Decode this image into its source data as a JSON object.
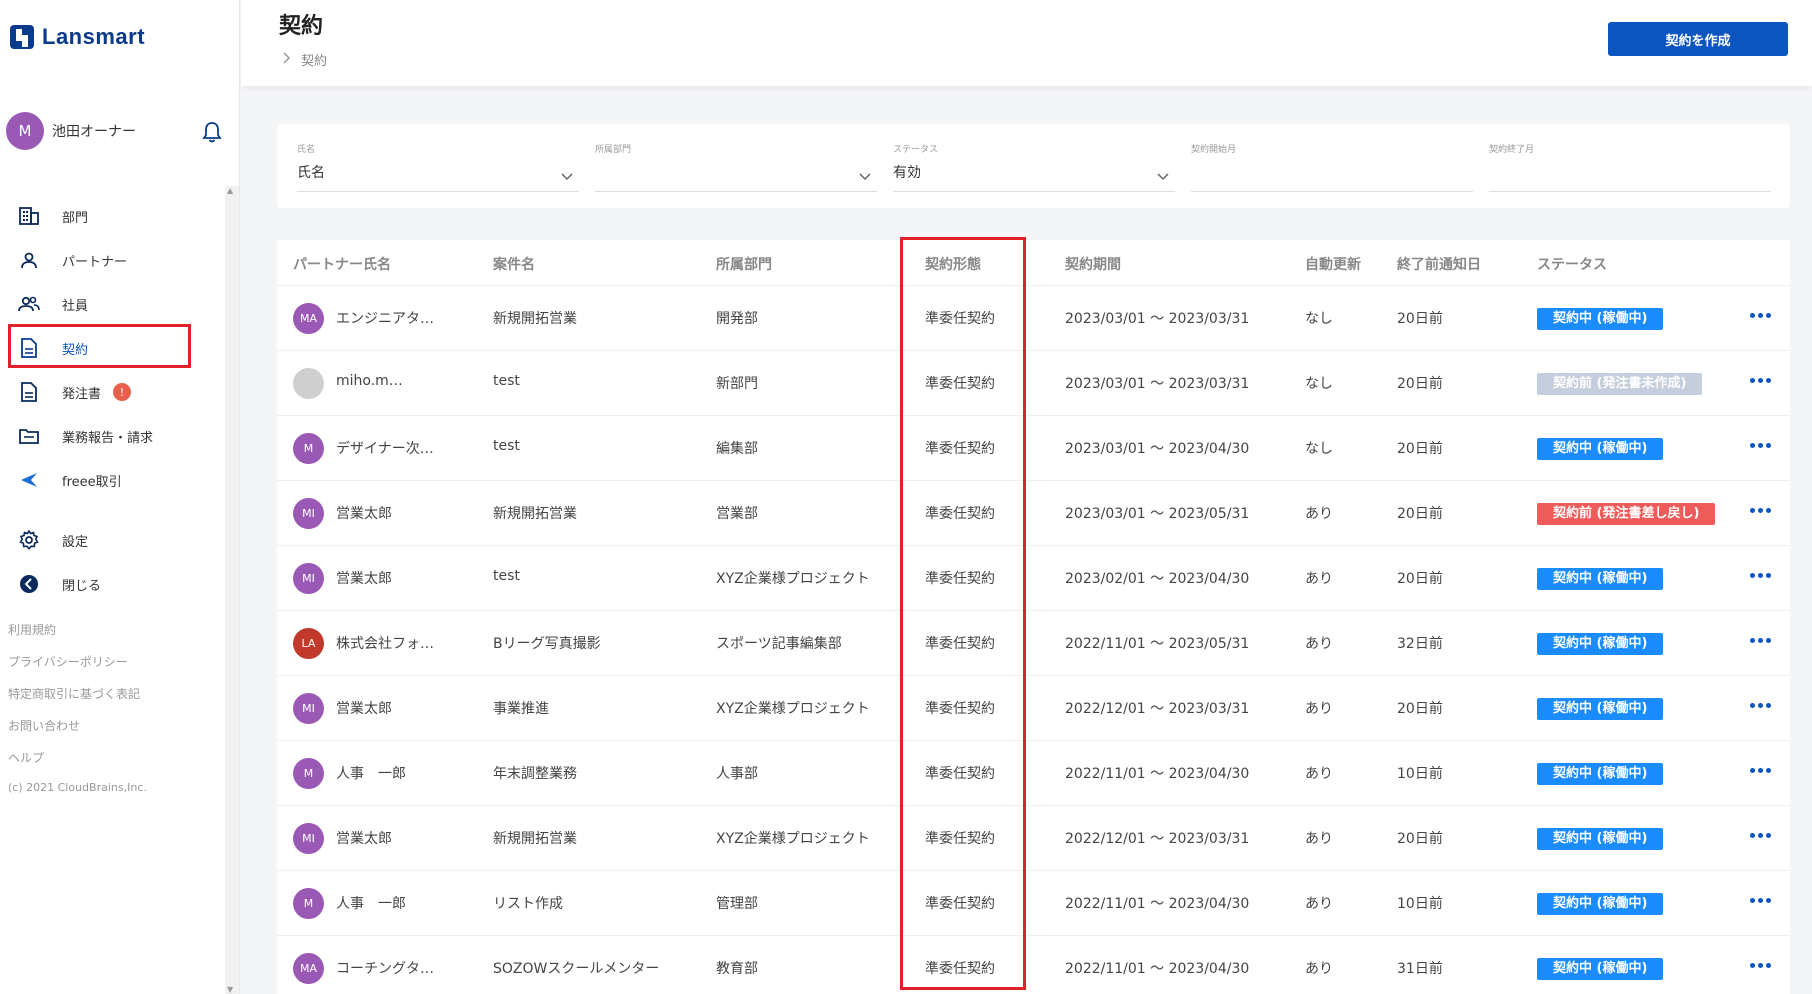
{
  "app": {
    "logo_text": "Lansmart"
  },
  "user": {
    "avatar_initial": "M",
    "name": "池田オーナー"
  },
  "nav": {
    "items": [
      {
        "label": "部門",
        "icon": "building-icon"
      },
      {
        "label": "パートナー",
        "icon": "person-icon"
      },
      {
        "label": "社員",
        "icon": "people-icon"
      },
      {
        "label": "契約",
        "icon": "document-icon",
        "active": true
      },
      {
        "label": "発注書",
        "icon": "document-icon",
        "badge": "!"
      },
      {
        "label": "業務報告・請求",
        "icon": "folder-icon"
      },
      {
        "label": "freee取引",
        "icon": "freee-icon"
      }
    ],
    "settings_label": "設定",
    "close_label": "閉じる"
  },
  "footer": {
    "links": [
      "利用規約",
      "プライバシーポリシー",
      "特定商取引に基づく表記",
      "お問い合わせ",
      "ヘルプ"
    ],
    "copyright": "(c) 2021 CloudBrains,Inc."
  },
  "header": {
    "title": "契約",
    "breadcrumb": "契約",
    "create_button": "契約を作成"
  },
  "filters": [
    {
      "label": "氏名",
      "value": "氏名",
      "dropdown": true
    },
    {
      "label": "所属部門",
      "value": "",
      "dropdown": true
    },
    {
      "label": "ステータス",
      "value": "有効",
      "dropdown": true
    },
    {
      "label": "契約開始月",
      "value": "",
      "dropdown": false
    },
    {
      "label": "契約終了月",
      "value": "",
      "dropdown": false
    }
  ],
  "table": {
    "columns": [
      "パートナー氏名",
      "案件名",
      "所属部門",
      "契約形態",
      "契約期間",
      "自動更新",
      "終了前通知日",
      "ステータス"
    ],
    "rows": [
      {
        "initials": "MA",
        "avatar_color": "#9b59b6",
        "partner": "エンジニアタ…",
        "project": "新規開拓営業",
        "dept": "開発部",
        "type": "準委任契約",
        "period": "2023/03/01 ～ 2023/03/31",
        "auto": "なし",
        "notice": "20日前",
        "status": "契約中 (稼働中)",
        "status_color": "#1a8cff"
      },
      {
        "initials": "",
        "avatar_color": "#cfcfcf",
        "partner": "miho.m…",
        "project": "test",
        "dept": "新部門",
        "type": "準委任契約",
        "period": "2023/03/01 ～ 2023/03/31",
        "auto": "なし",
        "notice": "20日前",
        "status": "契約前 (発注書未作成)",
        "status_color": "#c5cedd"
      },
      {
        "initials": "M",
        "avatar_color": "#9b59b6",
        "partner": "デザイナー次…",
        "project": "test",
        "dept": "編集部",
        "type": "準委任契約",
        "period": "2023/03/01 ～ 2023/04/30",
        "auto": "なし",
        "notice": "20日前",
        "status": "契約中 (稼働中)",
        "status_color": "#1a8cff"
      },
      {
        "initials": "MI",
        "avatar_color": "#9b59b6",
        "partner": "営業太郎",
        "project": "新規開拓営業",
        "dept": "営業部",
        "type": "準委任契約",
        "period": "2023/03/01 ～ 2023/05/31",
        "auto": "あり",
        "notice": "20日前",
        "status": "契約前 (発注書差し戻し)",
        "status_color": "#ef5b5b"
      },
      {
        "initials": "MI",
        "avatar_color": "#9b59b6",
        "partner": "営業太郎",
        "project": "test",
        "dept": "XYZ企業様プロジェクト",
        "type": "準委任契約",
        "period": "2023/02/01 ～ 2023/04/30",
        "auto": "あり",
        "notice": "20日前",
        "status": "契約中 (稼働中)",
        "status_color": "#1a8cff"
      },
      {
        "initials": "LA",
        "avatar_color": "#c0392b",
        "partner": "株式会社フォ…",
        "project": "Bリーグ写真撮影",
        "dept": "スポーツ記事編集部",
        "type": "準委任契約",
        "period": "2022/11/01 ～ 2023/05/31",
        "auto": "あり",
        "notice": "32日前",
        "status": "契約中 (稼働中)",
        "status_color": "#1a8cff"
      },
      {
        "initials": "MI",
        "avatar_color": "#9b59b6",
        "partner": "営業太郎",
        "project": "事業推進",
        "dept": "XYZ企業様プロジェクト",
        "type": "準委任契約",
        "period": "2022/12/01 ～ 2023/03/31",
        "auto": "あり",
        "notice": "20日前",
        "status": "契約中 (稼働中)",
        "status_color": "#1a8cff"
      },
      {
        "initials": "M",
        "avatar_color": "#9b59b6",
        "partner": "人事　一郎",
        "project": "年末調整業務",
        "dept": "人事部",
        "type": "準委任契約",
        "period": "2022/11/01 ～ 2023/04/30",
        "auto": "あり",
        "notice": "10日前",
        "status": "契約中 (稼働中)",
        "status_color": "#1a8cff"
      },
      {
        "initials": "MI",
        "avatar_color": "#9b59b6",
        "partner": "営業太郎",
        "project": "新規開拓営業",
        "dept": "XYZ企業様プロジェクト",
        "type": "準委任契約",
        "period": "2022/12/01 ～ 2023/03/31",
        "auto": "あり",
        "notice": "20日前",
        "status": "契約中 (稼働中)",
        "status_color": "#1a8cff"
      },
      {
        "initials": "M",
        "avatar_color": "#9b59b6",
        "partner": "人事　一郎",
        "project": "リスト作成",
        "dept": "管理部",
        "type": "準委任契約",
        "period": "2022/11/01 ～ 2023/04/30",
        "auto": "あり",
        "notice": "10日前",
        "status": "契約中 (稼働中)",
        "status_color": "#1a8cff"
      },
      {
        "initials": "MA",
        "avatar_color": "#9b59b6",
        "partner": "コーチングタ…",
        "project": "SOZOWスクールメンター",
        "dept": "教育部",
        "type": "準委任契約",
        "period": "2022/11/01 ～ 2023/04/30",
        "auto": "あり",
        "notice": "31日前",
        "status": "契約中 (稼働中)",
        "status_color": "#1a8cff"
      }
    ]
  }
}
